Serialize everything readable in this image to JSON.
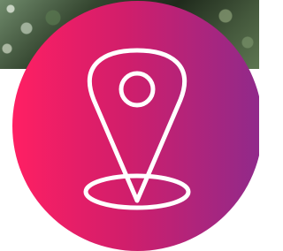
{
  "icon": {
    "name": "location-pin-icon",
    "gradient_start": "#ff1f63",
    "gradient_end": "#8f2a8b",
    "stroke_color": "#ffffff"
  },
  "background": {
    "top_photo": "foliage-photo",
    "panel_color": "#ffffff"
  }
}
